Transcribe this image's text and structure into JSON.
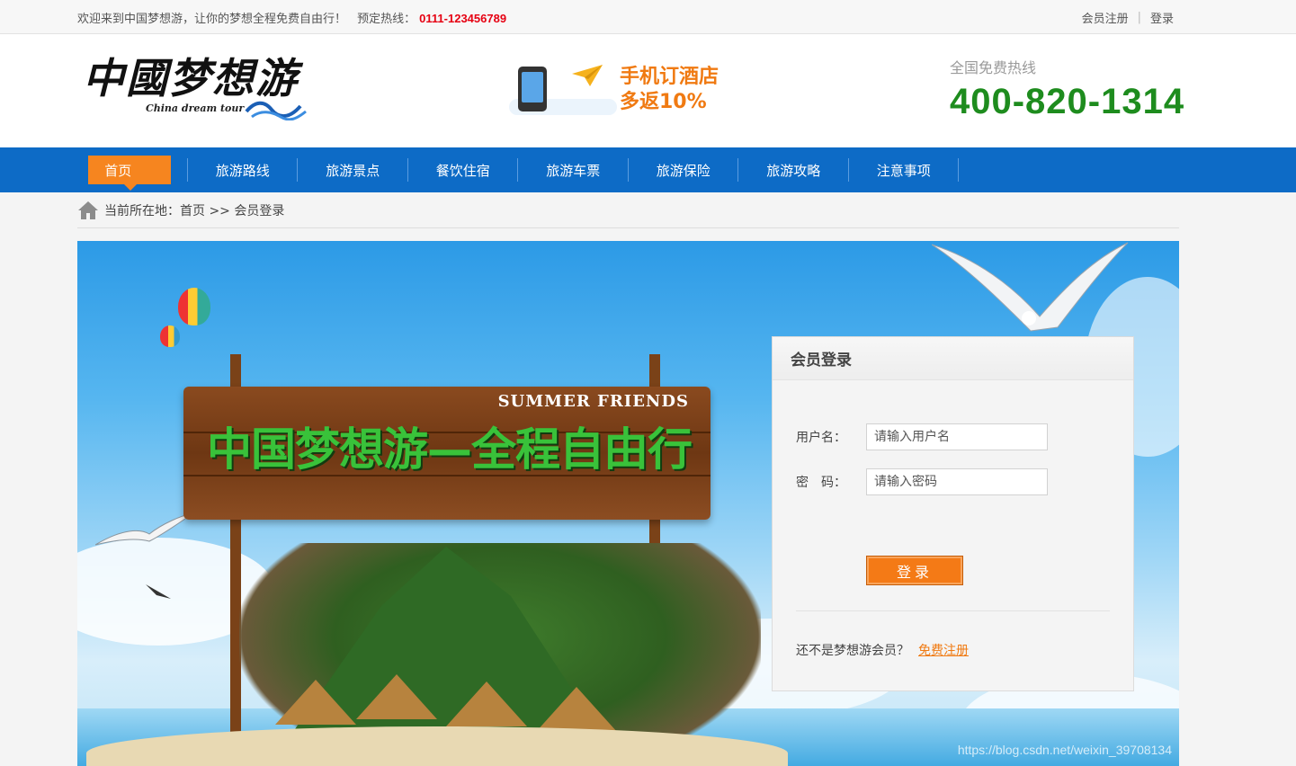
{
  "topbar": {
    "welcome": "欢迎来到中国梦想游，让你的梦想全程免费自由行！",
    "hotline_label": "预定热线：",
    "hotline_number": "0111-123456789",
    "register_link": "会员注册",
    "login_link": "登录"
  },
  "header": {
    "logo_text_1": "中國",
    "logo_text_2": "梦想游",
    "logo_sub": "China dream tour",
    "promo_line1": "手机订酒店",
    "promo_line2": "多返10%",
    "hotline_label": "全国免费热线",
    "hotline_number": "400-820-1314"
  },
  "nav": {
    "items": [
      {
        "label": "首页",
        "active": true
      },
      {
        "label": "旅游路线"
      },
      {
        "label": "旅游景点"
      },
      {
        "label": "餐饮住宿"
      },
      {
        "label": "旅游车票"
      },
      {
        "label": "旅游保险"
      },
      {
        "label": "旅游攻略"
      },
      {
        "label": "注意事项"
      }
    ]
  },
  "breadcrumb": {
    "text": "当前所在地：首页 >> 会员登录"
  },
  "banner": {
    "sign_top": "SUMMER FRIENDS",
    "sign_title": "中国梦想游—全程自由行"
  },
  "login": {
    "title": "会员登录",
    "username_label": "用户名：",
    "username_placeholder": "请输入用户名",
    "password_label": "密　码：",
    "password_placeholder": "请输入密码",
    "submit_label": "登录",
    "register_prompt": "还不是梦想游会员？",
    "register_link": "免费注册"
  },
  "watermark": "https://blog.csdn.net/weixin_39708134",
  "colors": {
    "nav_bg": "#0d6bc6",
    "accent_orange": "#f6851f",
    "hotline_green": "#1e8c1e",
    "hotline_red": "#e60012"
  }
}
